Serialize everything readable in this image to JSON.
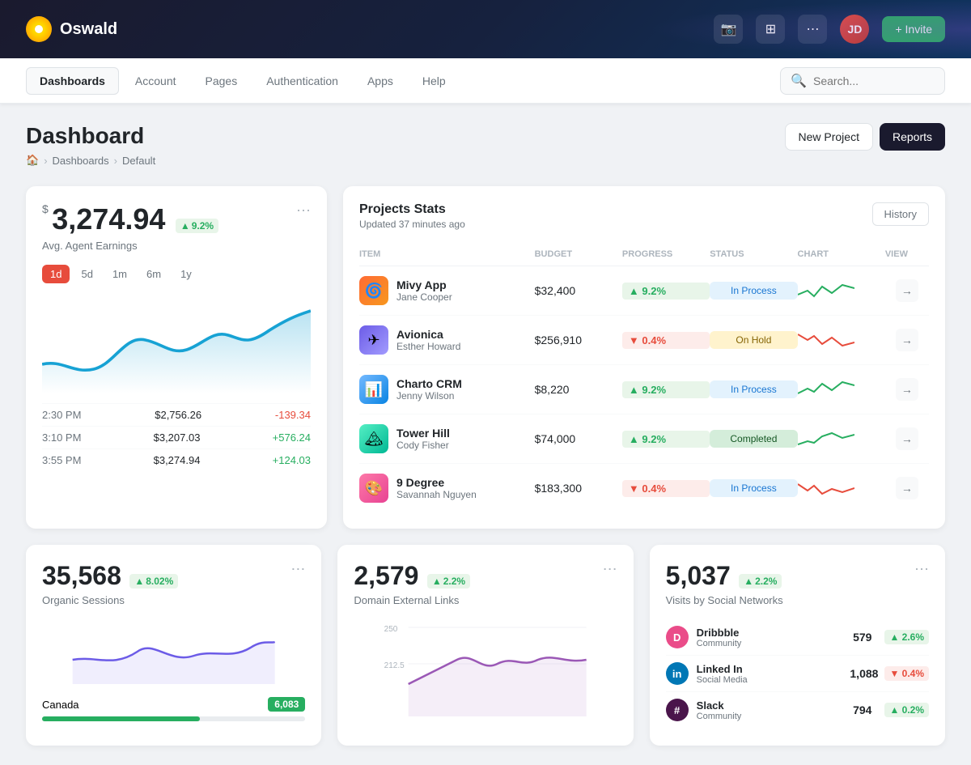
{
  "topnav": {
    "logo_text": "Oswald",
    "invite_label": "+ Invite"
  },
  "secnav": {
    "items": [
      {
        "label": "Dashboards",
        "active": true
      },
      {
        "label": "Account",
        "active": false
      },
      {
        "label": "Pages",
        "active": false
      },
      {
        "label": "Authentication",
        "active": false
      },
      {
        "label": "Apps",
        "active": false
      },
      {
        "label": "Help",
        "active": false
      }
    ],
    "search_placeholder": "Search..."
  },
  "page": {
    "title": "Dashboard",
    "breadcrumb": [
      "Home",
      "Dashboards",
      "Default"
    ],
    "actions": {
      "new_project": "New Project",
      "reports": "Reports"
    }
  },
  "earnings": {
    "symbol": "$",
    "value": "3,274.94",
    "badge": "9.2%",
    "label": "Avg. Agent Earnings",
    "time_filters": [
      "1d",
      "5d",
      "1m",
      "6m",
      "1y"
    ],
    "active_filter": "1d",
    "rows": [
      {
        "time": "2:30 PM",
        "amount": "$2,756.26",
        "change": "-139.34",
        "positive": false
      },
      {
        "time": "3:10 PM",
        "amount": "$3,207.03",
        "change": "+576.24",
        "positive": true
      },
      {
        "time": "3:55 PM",
        "amount": "$3,274.94",
        "change": "+124.03",
        "positive": true
      }
    ]
  },
  "projects": {
    "title": "Projects Stats",
    "updated": "Updated 37 minutes ago",
    "history_label": "History",
    "columns": [
      "ITEM",
      "BUDGET",
      "PROGRESS",
      "STATUS",
      "CHART",
      "VIEW"
    ],
    "rows": [
      {
        "name": "Mivy App",
        "person": "Jane Cooper",
        "budget": "$32,400",
        "progress": "9.2%",
        "progress_up": true,
        "status": "In Process",
        "status_type": "inprocess",
        "icon_bg": "#ff6b35",
        "icon": "🌀"
      },
      {
        "name": "Avionica",
        "person": "Esther Howard",
        "budget": "$256,910",
        "progress": "0.4%",
        "progress_up": false,
        "status": "On Hold",
        "status_type": "onhold",
        "icon_bg": "#6c5ce7",
        "icon": "✈"
      },
      {
        "name": "Charto CRM",
        "person": "Jenny Wilson",
        "budget": "$8,220",
        "progress": "9.2%",
        "progress_up": true,
        "status": "In Process",
        "status_type": "inprocess",
        "icon_bg": "#74b9ff",
        "icon": "📊"
      },
      {
        "name": "Tower Hill",
        "person": "Cody Fisher",
        "budget": "$74,000",
        "progress": "9.2%",
        "progress_up": true,
        "status": "Completed",
        "status_type": "completed",
        "icon_bg": "#55efc4",
        "icon": "🏔"
      },
      {
        "name": "9 Degree",
        "person": "Savannah Nguyen",
        "budget": "$183,300",
        "progress": "0.4%",
        "progress_up": false,
        "status": "In Process",
        "status_type": "inprocess",
        "icon_bg": "#fd79a8",
        "icon": "🎨"
      }
    ]
  },
  "organic": {
    "value": "35,568",
    "badge": "8.02%",
    "label": "Organic Sessions",
    "geo": {
      "country": "Canada",
      "count": "6,083",
      "percent": 60
    }
  },
  "external_links": {
    "value": "2,579",
    "badge": "2.2%",
    "label": "Domain External Links"
  },
  "social": {
    "value": "5,037",
    "badge": "2.2%",
    "label": "Visits by Social Networks",
    "rows": [
      {
        "name": "Dribbble",
        "type": "Community",
        "count": "579",
        "change": "2.6%",
        "up": true,
        "color": "#ea4c89"
      },
      {
        "name": "Linked In",
        "type": "Social Media",
        "count": "1,088",
        "change": "0.4%",
        "up": false,
        "color": "#0077b5"
      },
      {
        "name": "Slack",
        "type": "Community",
        "count": "794",
        "change": "0.2%",
        "up": true,
        "color": "#4a154b"
      }
    ]
  }
}
